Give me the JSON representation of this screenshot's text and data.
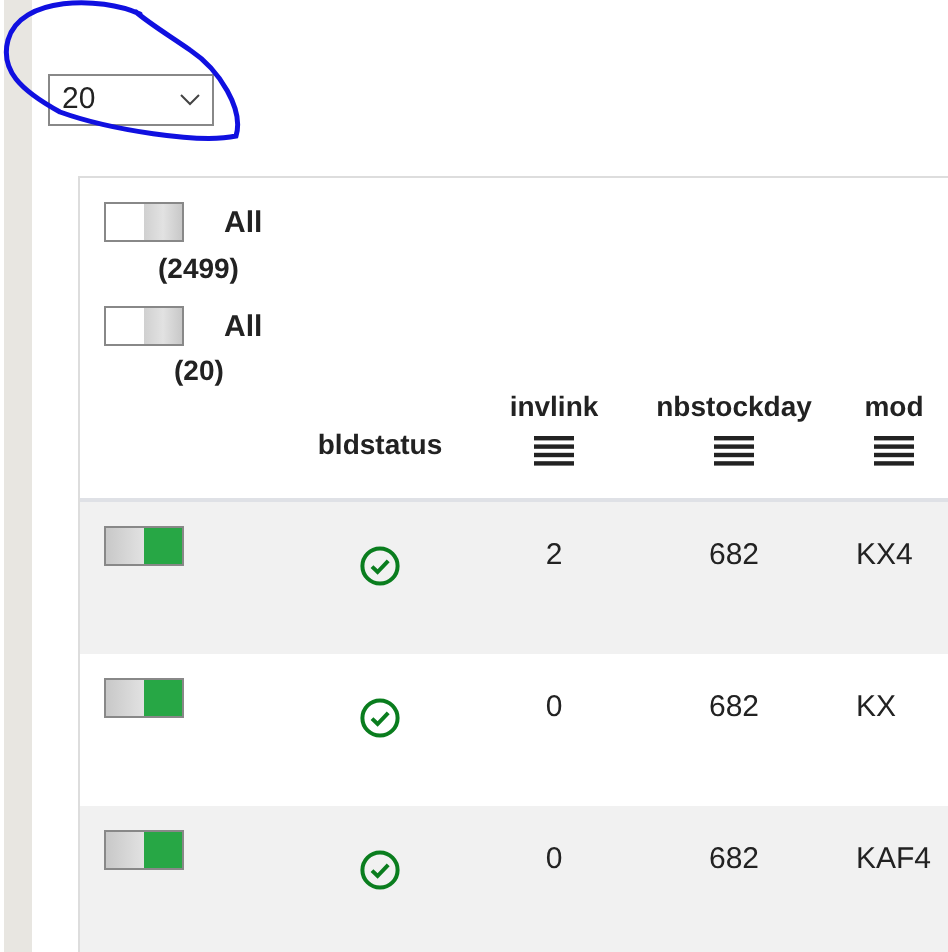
{
  "page_size": {
    "value": "20"
  },
  "annotation": {
    "kind": "freehand-circle"
  },
  "filters": [
    {
      "label": "All",
      "count": "(2499)",
      "on": false
    },
    {
      "label": "All",
      "count": "(20)",
      "on": false
    }
  ],
  "columns": [
    {
      "label": "bldstatus",
      "menu_icon": false
    },
    {
      "label": "invlink",
      "menu_icon": true
    },
    {
      "label": "nbstockday",
      "menu_icon": true
    },
    {
      "label": "mod",
      "menu_icon": true
    }
  ],
  "rows": [
    {
      "on": true,
      "kind": "ok",
      "invlink": "2",
      "nbstockday": "682",
      "model": "KX4"
    },
    {
      "on": true,
      "kind": "ok",
      "invlink": "0",
      "nbstockday": "682",
      "model": "KX"
    },
    {
      "on": true,
      "kind": "ok",
      "invlink": "0",
      "nbstockday": "682",
      "model": "KAF4"
    }
  ]
}
